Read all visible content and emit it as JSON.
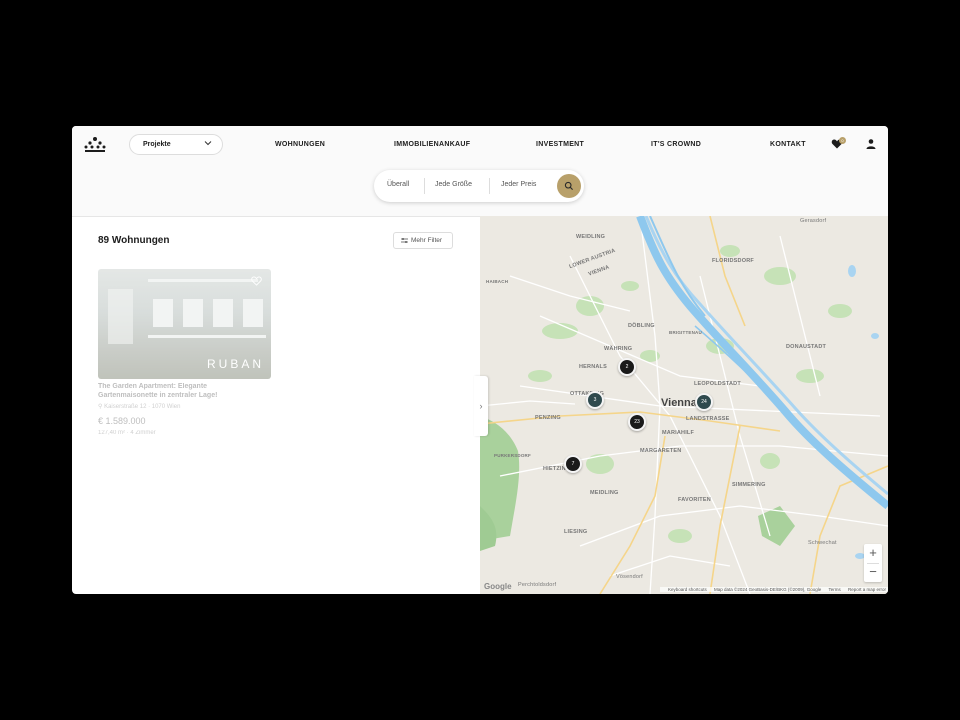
{
  "header": {
    "projects_select": "Projekte",
    "nav": [
      "WOHNUNGEN",
      "IMMOBILIENANKAUF",
      "INVESTMENT",
      "IT'S CROWND",
      "KONTAKT"
    ],
    "favorites_count": "0"
  },
  "search": {
    "location": "Überall",
    "size": "Jede Größe",
    "price": "Jeder Preis"
  },
  "results": {
    "count_label": "89 Wohnungen",
    "filter_label": "Mehr Filter"
  },
  "listing": {
    "image_text": "RUBAN",
    "title": "The Garden Apartment: Elegante Gartenmaisonette in zentraler Lage!",
    "address": "Kaiserstraße 12 · 1070 Wien",
    "price": "€ 1.589.000",
    "meta": "127,40 m² · 4 Zimmer"
  },
  "map": {
    "city_label": "Vienna",
    "districts": [
      "WEIDLING",
      "LOWER AUSTRIA",
      "VIENNA",
      "FLORIDSDORF",
      "HERNALS",
      "DÖBLING",
      "WÄHRING",
      "DONAUSTADT",
      "LEOPOLDSTADT",
      "OTTAKRING",
      "PENZING",
      "LANDSTRASSE",
      "MARIAHILF",
      "MARGARETEN",
      "HIETZING",
      "SIMMERING",
      "MEIDLING",
      "FAVORITEN",
      "LIESING",
      "Gerasdorf",
      "Schwechat",
      "Perchtoldsdorf",
      "Vösendorf",
      "BRIGITTENAU",
      "HAIBACH",
      "PURKERSDORF"
    ],
    "clusters": [
      {
        "count": "2",
        "color": "#1a1a1a"
      },
      {
        "count": "3",
        "color": "#2f4a4e"
      },
      {
        "count": "24",
        "color": "#2f4a4e"
      },
      {
        "count": "23",
        "color": "#1a1a1a"
      },
      {
        "count": "7",
        "color": "#1a1a1a"
      }
    ],
    "zoom_in": "+",
    "zoom_out": "−",
    "google": "Google",
    "attribution": [
      "Keyboard shortcuts",
      "Map data ©2024 GeoBasis-DE/BKG (©2009), Google",
      "Terms",
      "Report a map error"
    ]
  },
  "colors": {
    "accent": "#b8a06a",
    "cluster_dark": "#1a1a1a",
    "cluster_teal": "#2f4a4e"
  }
}
